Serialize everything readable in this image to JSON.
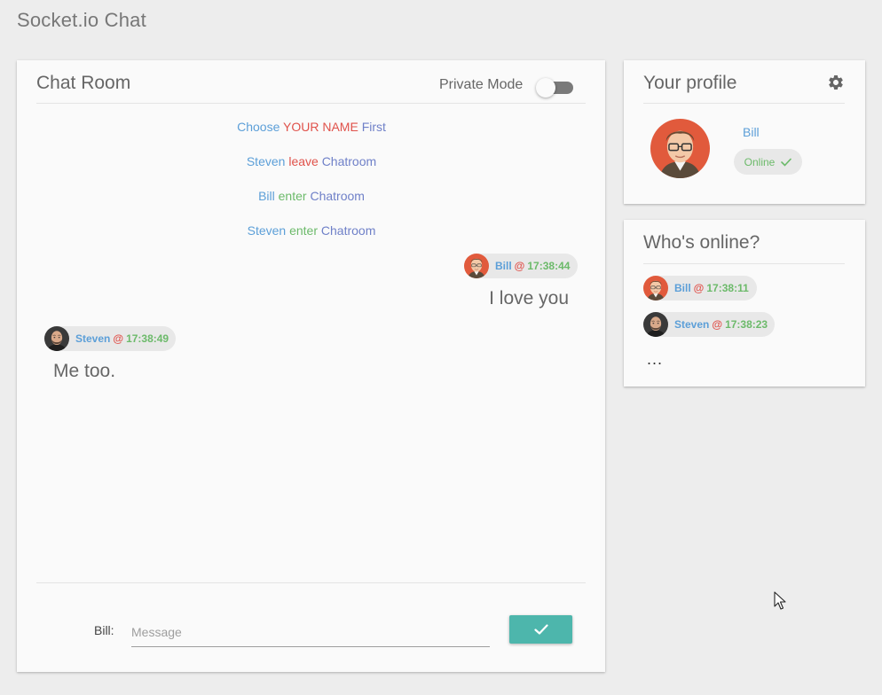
{
  "app": {
    "title": "Socket.io Chat"
  },
  "chat_room": {
    "title": "Chat Room",
    "private_mode": {
      "label": "Private Mode",
      "enabled": false
    },
    "system_messages": [
      {
        "parts": [
          "Choose",
          "YOUR NAME",
          "First"
        ]
      },
      {
        "parts": [
          "Steven",
          "leave",
          "Chatroom"
        ]
      },
      {
        "parts": [
          "Bill",
          "enter",
          "Chatroom"
        ]
      },
      {
        "parts": [
          "Steven",
          "enter",
          "Chatroom"
        ]
      }
    ],
    "messages": [
      {
        "user": "Bill",
        "at": "@",
        "time": "17:38:44",
        "text": "I love you",
        "side": "right"
      },
      {
        "user": "Steven",
        "at": "@",
        "time": "17:38:49",
        "text": "Me too.",
        "side": "left"
      }
    ],
    "composer": {
      "label": "Bill:",
      "placeholder": "Message",
      "value": ""
    }
  },
  "profile": {
    "title": "Your profile",
    "name": "Bill",
    "status": "Online"
  },
  "online": {
    "title": "Who's online?",
    "users": [
      {
        "name": "Bill",
        "at": "@",
        "time": "17:38:11"
      },
      {
        "name": "Steven",
        "at": "@",
        "time": "17:38:23"
      }
    ],
    "more": "..."
  },
  "icons": {
    "settings": "gear-icon",
    "send": "check-icon",
    "status": "check-icon",
    "switch": "toggle-off"
  },
  "colors": {
    "accent": "#4db6ac",
    "name_blue": "#5c9fd8",
    "at_red": "#e0524b",
    "time_green": "#6cba6a",
    "room_indigo": "#6f80c8"
  }
}
